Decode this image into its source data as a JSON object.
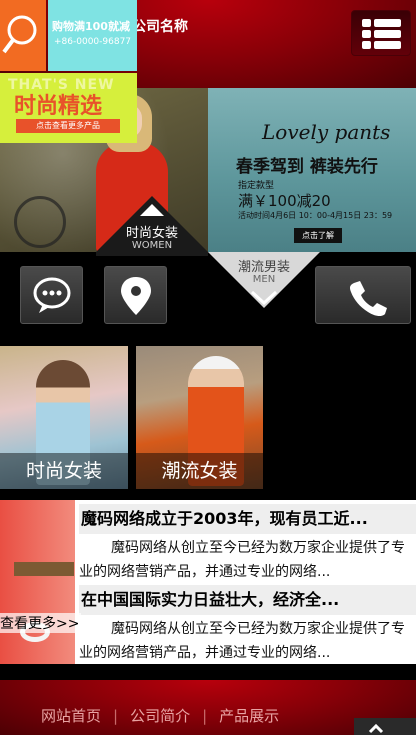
{
  "header": {
    "title": "您的公司名称"
  },
  "banner": {
    "headline_en": "Lovely pants",
    "slogan": "春季驾到 裤装先行",
    "kind": "指定款型",
    "offer": "满￥100减20",
    "dates": "活动时间4月6日 10：00-4月15日 23：59",
    "button": "点击了解"
  },
  "tabs": {
    "women": {
      "label": "时尚女装",
      "sub": "WOMEN"
    },
    "men": {
      "label": "潮流男装",
      "sub": "MEN"
    }
  },
  "tiles": {
    "t1": "时尚女装",
    "t2": "潮流女装",
    "t3_promo": "购物满100就减",
    "t3_phone": "+86-0000-96877",
    "t3_ghost": "THAT'S NEW",
    "t3_big": "时尚精选",
    "t3_cta": "点击查看更多产品"
  },
  "news": {
    "items": [
      {
        "title": "魔码网络成立于2003年，现有员工近...",
        "body": "魔码网络从创立至今已经为数万家企业提供了专业的网络营销产品，并通过专业的网络..."
      },
      {
        "title": "在中国国际实力日益壮大，经济全...",
        "body": "魔码网络从创立至今已经为数万家企业提供了专业的网络营销产品，并通过专业的网络..."
      }
    ],
    "more": "查看更多>>"
  },
  "footer": {
    "nav": [
      "网站首页",
      "公司简介",
      "产品展示"
    ]
  },
  "colors": {
    "brand_red": "#8a0008",
    "accent_orange": "#f26b22",
    "accent_cyan": "#7fe3e3",
    "accent_lime": "#d6ef3c"
  }
}
